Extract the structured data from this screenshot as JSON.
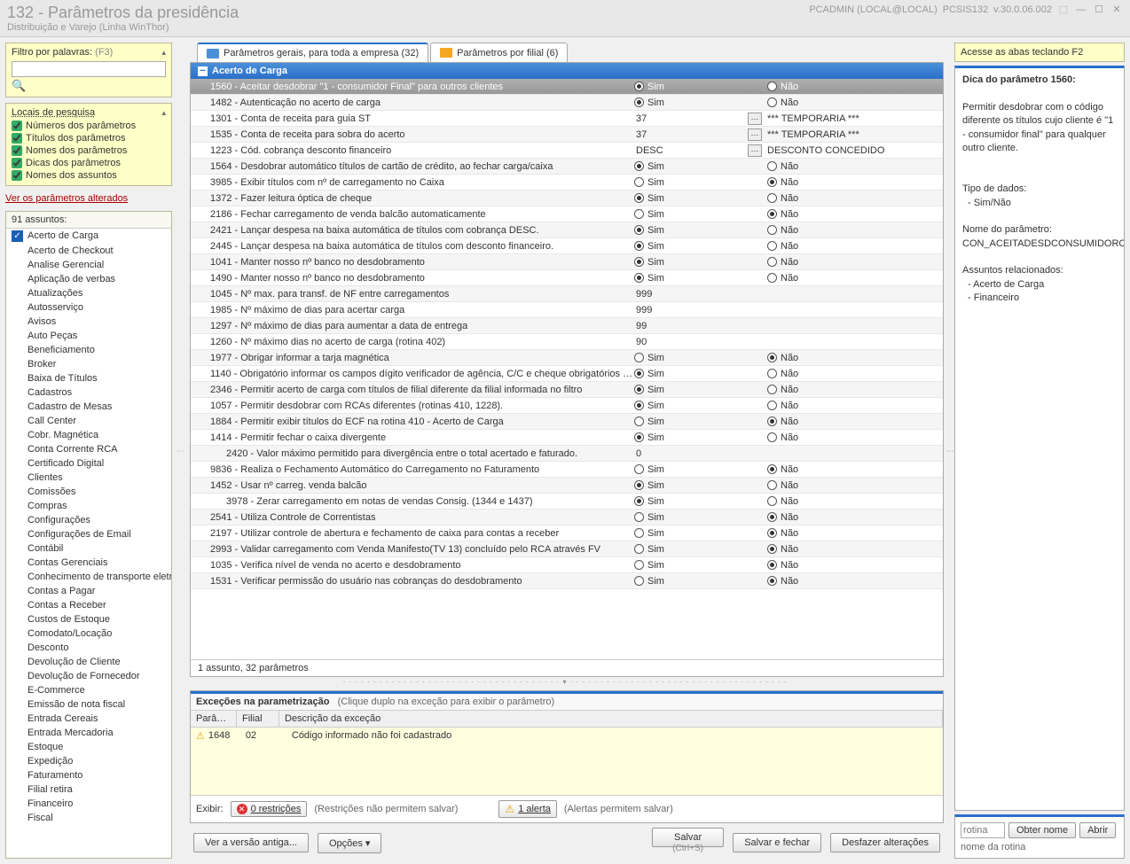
{
  "window": {
    "title": "132 - Parâmetros da presidência",
    "subtitle": "Distribuição e Varejo (Linha WinThor)",
    "user": "PCADMIN (LOCAL@LOCAL)",
    "module": "PCSIS132",
    "version": "v.30.0.06.002"
  },
  "filter": {
    "label": "Filtro por palavras:",
    "hint": "(F3)"
  },
  "search_locations": {
    "title": "Locais de pesquisa",
    "items": [
      {
        "label": "Números dos parâmetros",
        "checked": true
      },
      {
        "label": "Títulos dos parâmetros",
        "checked": true
      },
      {
        "label": "Nomes dos parâmetros",
        "checked": true
      },
      {
        "label": "Dicas dos parâmetros",
        "checked": true
      },
      {
        "label": "Nomes dos assuntos",
        "checked": true
      }
    ]
  },
  "altered_link": "Ver os parâmetros alterados",
  "subjects": {
    "count_label": "91 assuntos:",
    "items": [
      "Acerto de Carga",
      "Acerto de Checkout",
      "Analise Gerencial",
      "Aplicação de verbas",
      "Atualizações",
      "Autosserviço",
      "Avisos",
      "Auto Peças",
      "Beneficiamento",
      "Broker",
      "Baixa de Títulos",
      "Cadastros",
      "Cadastro de Mesas",
      "Call Center",
      "Cobr. Magnética",
      "Conta Corrente RCA",
      "Certificado Digital",
      "Clientes",
      "Comissões",
      "Compras",
      "Configurações",
      "Configurações de Email",
      "Contábil",
      "Contas Gerenciais",
      "Conhecimento de transporte eletrônico",
      "Contas a Pagar",
      "Contas a Receber",
      "Custos de Estoque",
      "Comodato/Locação",
      "Desconto",
      "Devolução de Cliente",
      "Devolução de Fornecedor",
      "E-Commerce",
      "Emissão de nota fiscal",
      "Entrada Cereais",
      "Entrada Mercadoria",
      "Estoque",
      "Expedição",
      "Faturamento",
      "Filial retira",
      "Financeiro",
      "Fiscal"
    ],
    "selected": 0
  },
  "tabs": [
    {
      "label": "Parâmetros gerais, para toda a empresa  (32)",
      "active": true,
      "color": "blue",
      "hotkey": "â"
    },
    {
      "label": "Parâmetros por filial  (6)",
      "active": false,
      "color": "orange",
      "hotkey": "â"
    }
  ],
  "group_title": "Acerto de Carga",
  "sim": "Sim",
  "nao": "Não",
  "params": [
    {
      "id": "1560",
      "desc": "Aceitar desdobrar \"1 - consumidor Final\" para outros clientes",
      "type": "radio",
      "v": "sim",
      "selected": true
    },
    {
      "id": "1482",
      "desc": "Autenticação no acerto de carga",
      "type": "radio",
      "v": "sim"
    },
    {
      "id": "1301",
      "desc": "Conta de receita para guia ST",
      "type": "text",
      "val": "37",
      "extra": "*** TEMPORARIA ***",
      "pick": true
    },
    {
      "id": "1535",
      "desc": "Conta de receita para sobra do acerto",
      "type": "text",
      "val": "37",
      "extra": "*** TEMPORARIA ***",
      "pick": true
    },
    {
      "id": "1223",
      "desc": "Cód. cobrança desconto financeiro",
      "type": "text",
      "val": "DESC",
      "extra": "DESCONTO CONCEDIDO",
      "pick": true
    },
    {
      "id": "1564",
      "desc": "Desdobrar automático títulos de cartão de crédito, ao fechar carga/caixa",
      "type": "radio",
      "v": "sim"
    },
    {
      "id": "3985",
      "desc": "Exibir títulos com nº de carregamento no Caixa",
      "type": "radio",
      "v": "nao"
    },
    {
      "id": "1372",
      "desc": "Fazer leitura óptica de cheque",
      "type": "radio",
      "v": "sim"
    },
    {
      "id": "2186",
      "desc": "Fechar carregamento de venda balcão automaticamente",
      "type": "radio",
      "v": "nao"
    },
    {
      "id": "2421",
      "desc": "Lançar despesa na baixa automática de títulos com cobrança DESC.",
      "type": "radio",
      "v": "sim"
    },
    {
      "id": "2445",
      "desc": "Lançar despesa na baixa automática de títulos com desconto financeiro.",
      "type": "radio",
      "v": "sim"
    },
    {
      "id": "1041",
      "desc": "Manter nosso nº banco no desdobramento",
      "type": "radio",
      "v": "sim"
    },
    {
      "id": "1490",
      "desc": "Manter nosso nº banco no desdobramento",
      "type": "radio",
      "v": "sim"
    },
    {
      "id": "1045",
      "desc": "Nº max. para transf. de NF entre carregamentos",
      "type": "text",
      "val": "999"
    },
    {
      "id": "1985",
      "desc": "Nº máximo de dias para acertar carga",
      "type": "text",
      "val": "999"
    },
    {
      "id": "1297",
      "desc": "Nº máximo de dias para aumentar a data de entrega",
      "type": "text",
      "val": "99"
    },
    {
      "id": "1260",
      "desc": "Nº máximo dias no acerto de carga (rotina 402)",
      "type": "text",
      "val": "90"
    },
    {
      "id": "1977",
      "desc": "Obrigar informar a tarja magnética",
      "type": "radio",
      "v": "nao"
    },
    {
      "id": "1140",
      "desc": "Obrigatório informar os campos dígito verificador de agência, C/C e cheque obrigatórios no desdobramento",
      "type": "radio",
      "v": "sim"
    },
    {
      "id": "2346",
      "desc": "Permitir acerto de carga com títulos de filial diferente da filial informada no filtro",
      "type": "radio",
      "v": "sim"
    },
    {
      "id": "1057",
      "desc": "Permitir desdobrar com RCAs diferentes (rotinas 410, 1228).",
      "type": "radio",
      "v": "sim"
    },
    {
      "id": "1884",
      "desc": "Permitir exibir títulos do ECF na rotina 410 - Acerto de Carga",
      "type": "radio",
      "v": "nao"
    },
    {
      "id": "1414",
      "desc": "Permitir fechar o caixa divergente",
      "type": "radio",
      "v": "sim"
    },
    {
      "id": "2420",
      "desc": "Valor máximo permitido para divergência entre o total acertado e faturado.",
      "type": "text",
      "val": "0",
      "indent": true
    },
    {
      "id": "9836",
      "desc": "Realiza o Fechamento Automático do Carregamento no Faturamento",
      "type": "radio",
      "v": "nao"
    },
    {
      "id": "1452",
      "desc": "Usar nº carreg. venda balcão",
      "type": "radio",
      "v": "sim"
    },
    {
      "id": "3978",
      "desc": "Zerar carregamento em notas de vendas Consig. (1344 e 1437)",
      "type": "radio",
      "v": "sim",
      "indent": true
    },
    {
      "id": "2541",
      "desc": "Utiliza Controle de Correntistas",
      "type": "radio",
      "v": "nao"
    },
    {
      "id": "2197",
      "desc": "Utilizar controle de abertura e fechamento de caixa para contas a receber",
      "type": "radio",
      "v": "nao"
    },
    {
      "id": "2993",
      "desc": "Validar carregamento com Venda Manifesto(TV 13) concluído pelo RCA através FV",
      "type": "radio",
      "v": "nao"
    },
    {
      "id": "1035",
      "desc": "Verifica nível de venda no acerto e desdobramento",
      "type": "radio",
      "v": "nao"
    },
    {
      "id": "1531",
      "desc": "Verificar permissão do usuário nas cobranças do desdobramento",
      "type": "radio",
      "v": "nao"
    }
  ],
  "status": "1 assunto, 32 parâmetros",
  "exceptions": {
    "title": "Exceções na parametrização",
    "hint": "(Clique duplo na exceção para exibir o parâmetro)",
    "cols": [
      "Parâ…",
      "Filial",
      "Descrição da exceção"
    ],
    "row": {
      "param": "1648",
      "filial": "02",
      "desc": "Código informado não foi cadastrado"
    },
    "exibir": "Exibir:",
    "restr_count": "0 restrições",
    "restr_hint": "(Restrições não permitem salvar)",
    "alert_count": "1 alerta",
    "alert_hint": "(Alertas permitem salvar)"
  },
  "buttons": {
    "old_version": "Ver a versão antiga...",
    "options": "Opções ▾",
    "save": "Salvar",
    "save_close": "Salvar e fechar",
    "undo": "Desfazer alterações",
    "save_shortcut": "(Ctrl+S)"
  },
  "right": {
    "hint": "Acesse as abas teclando F2",
    "tip_title": "Dica do parâmetro 1560:",
    "tip_body": "Permitir desdobrar com o código diferente os títulos cujo cliente é \"1 - consumidor final\" para qualquer outro cliente.",
    "datatype_label": "Tipo de dados:",
    "datatype": "- Sim/Não",
    "pname_label": "Nome do parâmetro:",
    "pname": "CON_ACEITADESDCONSUMIDOROUT",
    "related_label": "Assuntos relacionados:",
    "related": [
      "- Acerto de Carga",
      "- Financeiro"
    ],
    "rotina_placeholder": "rotina",
    "obter": "Obter nome",
    "abrir": "Abrir",
    "rotina_label": "nome da rotina"
  }
}
